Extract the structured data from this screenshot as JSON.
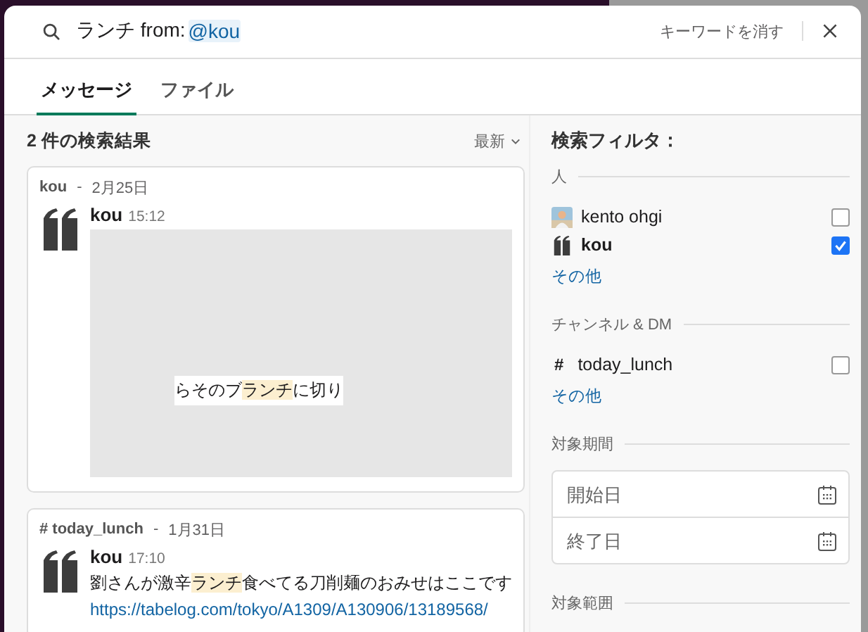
{
  "search": {
    "query": [
      {
        "kind": "text",
        "text": "ランチ from:"
      },
      {
        "kind": "mention",
        "text": "@kou"
      }
    ],
    "clear_label": "キーワードを消す"
  },
  "tabs": [
    {
      "label": "メッセージ",
      "selected": true
    },
    {
      "label": "ファイル",
      "selected": false
    }
  ],
  "results": {
    "count_label": "2 件の検索結果",
    "sort_label": "最新",
    "messages": [
      {
        "context": "kou",
        "separator": "-",
        "date": "2月25日",
        "author": "kou",
        "time": "15:12",
        "kind": "attachment",
        "segments": [
          {
            "text": "らそのブ",
            "highlight": false
          },
          {
            "text": "ランチ",
            "highlight": true
          },
          {
            "text": "に切り",
            "highlight": false
          }
        ]
      },
      {
        "context": "# today_lunch",
        "separator": "-",
        "date": "1月31日",
        "author": "kou",
        "time": "17:10",
        "kind": "text",
        "segments": [
          {
            "text": "劉さんが激辛",
            "highlight": false
          },
          {
            "text": "ランチ",
            "highlight": true
          },
          {
            "text": "食べてる刀削麺のおみせはここです",
            "highlight": false
          }
        ],
        "link": "https://tabelog.com/tokyo/A1309/A130906/13189568/"
      }
    ]
  },
  "filters": {
    "title": "検索フィルタ：",
    "people": {
      "label": "人",
      "items": [
        {
          "name": "kento ohgi",
          "checked": false
        },
        {
          "name": "kou",
          "kind": "books",
          "checked": true
        }
      ],
      "more": "その他"
    },
    "channels": {
      "label": "チャンネル & DM",
      "items": [
        {
          "prefix": "#",
          "name": "today_lunch",
          "checked": false
        }
      ],
      "more": "その他"
    },
    "period": {
      "label": "対象期間",
      "fields": [
        {
          "placeholder": "開始日"
        },
        {
          "placeholder": "終了日"
        }
      ]
    },
    "scope": {
      "label": "対象範囲"
    }
  }
}
